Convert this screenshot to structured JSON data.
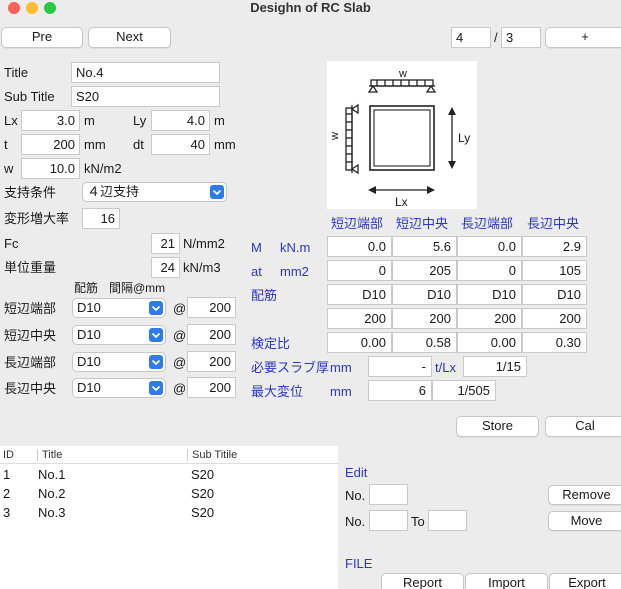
{
  "window": {
    "title": "Desighn of RC Slab"
  },
  "nav": {
    "pre": "Pre",
    "next": "Next",
    "page": "4",
    "sep": "/",
    "total": "3",
    "add": "+"
  },
  "form": {
    "title_label": "Title",
    "title_value": "No.4",
    "subtitle_label": "Sub Title",
    "subtitle_value": "S20",
    "lx_label": "Lx",
    "lx_value": "3.0",
    "lx_unit": "m",
    "ly_label": "Ly",
    "ly_value": "4.0",
    "ly_unit": "m",
    "t_label": "t",
    "t_value": "200",
    "t_unit": "mm",
    "dt_label": "dt",
    "dt_value": "40",
    "dt_unit": "mm",
    "w_label": "w",
    "w_value": "10.0",
    "w_unit": "kN/m2",
    "support_label": "支持条件",
    "support_value": "４辺支持",
    "factor_label": "変形増大率",
    "factor_value": "16",
    "fc_label": "Fc",
    "fc_value": "21",
    "fc_unit": "N/mm2",
    "weight_label": "単位重量",
    "weight_value": "24",
    "weight_unit": "kN/m3",
    "rebar_header": "配筋",
    "spacing_header": "間隔@mm",
    "rebars": [
      {
        "label": "短辺端部",
        "bar": "D10",
        "at": "@",
        "spacing": "200"
      },
      {
        "label": "短辺中央",
        "bar": "D10",
        "at": "@",
        "spacing": "200"
      },
      {
        "label": "長辺端部",
        "bar": "D10",
        "at": "@",
        "spacing": "200"
      },
      {
        "label": "長辺中央",
        "bar": "D10",
        "at": "@",
        "spacing": "200"
      }
    ]
  },
  "diagram": {
    "w_top": "w",
    "w_left": "w",
    "ly": "Ly",
    "lx": "Lx"
  },
  "results": {
    "headers": [
      "短辺端部",
      "短辺中央",
      "長辺端部",
      "長辺中央"
    ],
    "m_label": "M",
    "m_unit": "kN.m",
    "m_values": [
      "0.0",
      "5.6",
      "0.0",
      "2.9"
    ],
    "at_label": "at",
    "at_unit": "mm2",
    "at_values": [
      "0",
      "205",
      "0",
      "105"
    ],
    "rebar_label": "配筋",
    "rebar_values": [
      "D10",
      "D10",
      "D10",
      "D10"
    ],
    "spacing_values": [
      "200",
      "200",
      "200",
      "200"
    ],
    "check_label": "検定比",
    "check_values": [
      "0.00",
      "0.58",
      "0.00",
      "0.30"
    ],
    "thick_label": "必要スラブ厚",
    "thick_unit": "mm",
    "thick_value": "-",
    "tlx_label": "t/Lx",
    "tlx_value": "1/15",
    "defl_label": "最大変位",
    "defl_unit": "mm",
    "defl_value": "6",
    "defl_ratio": "1/505"
  },
  "actions": {
    "store": "Store",
    "cal": "Cal"
  },
  "list": {
    "headers": [
      "ID",
      "Title",
      "Sub Titile"
    ],
    "rows": [
      {
        "id": "1",
        "title": "No.1",
        "sub": "S20"
      },
      {
        "id": "2",
        "title": "No.2",
        "sub": "S20"
      },
      {
        "id": "3",
        "title": "No.3",
        "sub": "S20"
      }
    ]
  },
  "edit": {
    "title": "Edit",
    "no_label": "No.",
    "no2_label": "No.",
    "to_label": "To",
    "remove": "Remove",
    "move": "Move",
    "file_label": "FILE",
    "report": "Report",
    "import": "Import",
    "export": "Export"
  },
  "colors": {
    "accent_blue": "#2a35d4",
    "select_blue": "#2c7bf2"
  }
}
